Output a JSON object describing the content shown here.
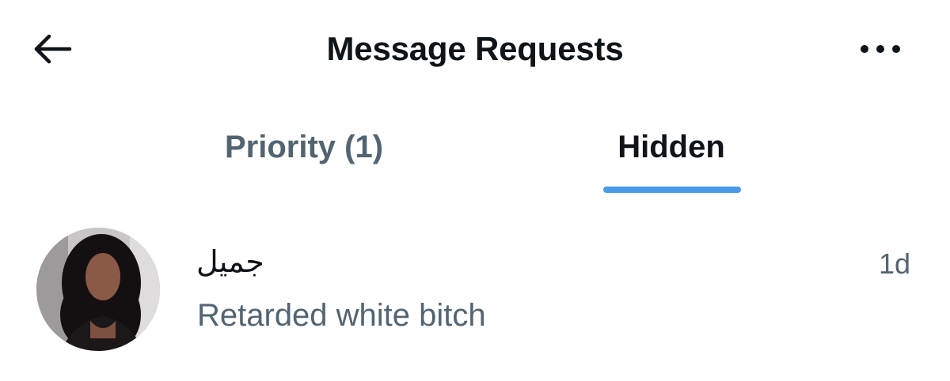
{
  "header": {
    "title": "Message Requests",
    "back_icon": "arrow-left-icon",
    "more_icon": "more-horizontal-icon"
  },
  "tabs": [
    {
      "label": "Priority (1)",
      "selected": false
    },
    {
      "label": "Hidden",
      "selected": true
    }
  ],
  "colors": {
    "accent": "#4a99e9",
    "primary_text": "#0f1419",
    "secondary_text": "#536471",
    "background": "#ffffff"
  },
  "conversations": [
    {
      "name": "جميل",
      "preview": "Retarded white bitch",
      "time": "1d"
    }
  ]
}
